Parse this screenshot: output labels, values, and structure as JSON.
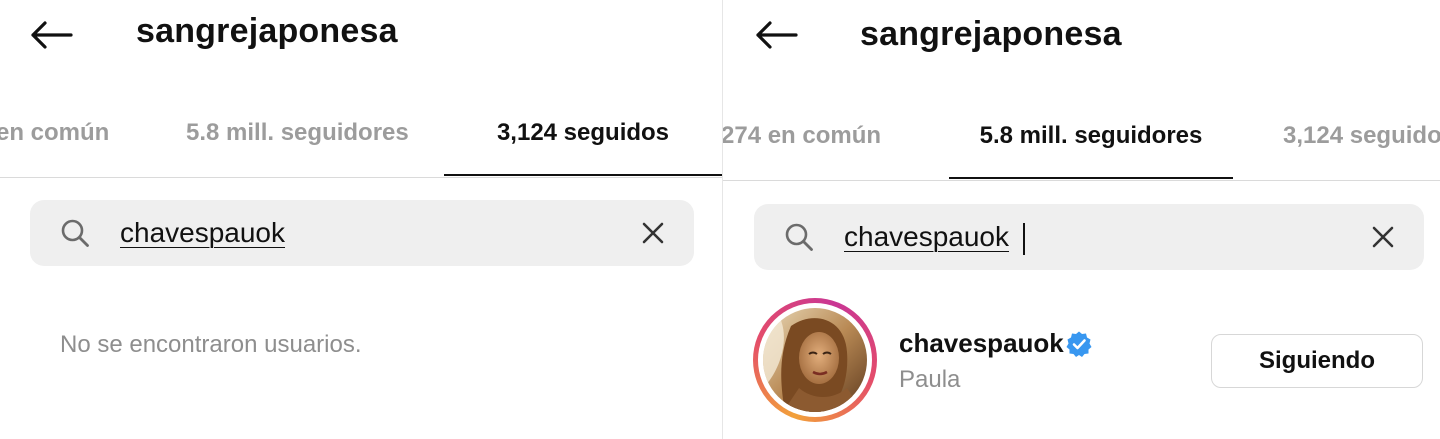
{
  "left_screen": {
    "header": {
      "username": "sangrejaponesa",
      "back_icon": "arrow-left-icon"
    },
    "tabs": [
      {
        "label": "en común",
        "active": false
      },
      {
        "label": "5.8 mill. seguidores",
        "active": false
      },
      {
        "label": "3,124 seguidos",
        "active": true
      }
    ],
    "search": {
      "value": "chavespauok",
      "search_icon": "search-icon",
      "clear_icon": "close-icon"
    },
    "empty_message": "No se encontraron usuarios."
  },
  "right_screen": {
    "header": {
      "username": "sangrejaponesa",
      "back_icon": "arrow-left-icon"
    },
    "tabs": [
      {
        "label": "274 en común",
        "active": false
      },
      {
        "label": "5.8 mill. seguidores",
        "active": true
      },
      {
        "label": "3,124 seguido",
        "active": false
      }
    ],
    "search": {
      "value": "chavespauok",
      "search_icon": "search-icon",
      "clear_icon": "close-icon"
    },
    "result": {
      "handle": "chavespauok",
      "verified": true,
      "verified_icon": "verified-badge-icon",
      "name": "Paula",
      "button_label": "Siguiendo"
    }
  },
  "colors": {
    "text_primary": "#111111",
    "text_secondary": "#8e8e8e",
    "search_bg": "#efefef",
    "verified_blue": "#3897f0",
    "story_ring_start": "#f2a13a",
    "story_ring_end": "#c93694"
  }
}
